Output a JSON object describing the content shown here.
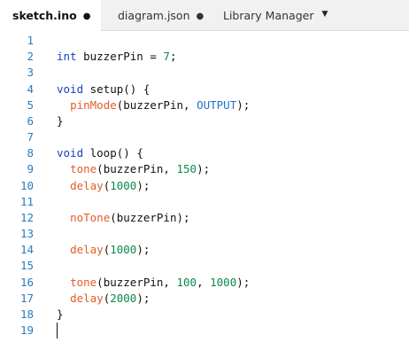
{
  "tabs": [
    {
      "label": "sketch.ino",
      "modified": "●",
      "active": true
    },
    {
      "label": "diagram.json",
      "modified": "●",
      "active": false
    },
    {
      "label": "Library Manager",
      "active": false
    }
  ],
  "more_icon": "▼",
  "colors": {
    "keyword": "#1a3fbf",
    "function": "#e35d26",
    "number": "#0b8a4a",
    "constant": "#1f74c8",
    "plain": "#111111",
    "line_number": "#2a7bbd"
  },
  "editor": {
    "lines": [
      {
        "number": "1",
        "tokens": []
      },
      {
        "number": "2",
        "tokens": [
          {
            "t": "int",
            "c": "keyword"
          },
          {
            "t": " buzzerPin = ",
            "c": "plain"
          },
          {
            "t": "7",
            "c": "number"
          },
          {
            "t": ";",
            "c": "plain"
          }
        ]
      },
      {
        "number": "3",
        "tokens": []
      },
      {
        "number": "4",
        "tokens": [
          {
            "t": "void",
            "c": "keyword"
          },
          {
            "t": " setup() {",
            "c": "plain"
          }
        ]
      },
      {
        "number": "5",
        "tokens": [
          {
            "t": "  ",
            "c": "plain"
          },
          {
            "t": "pinMode",
            "c": "function"
          },
          {
            "t": "(buzzerPin, ",
            "c": "plain"
          },
          {
            "t": "OUTPUT",
            "c": "constant"
          },
          {
            "t": ");",
            "c": "plain"
          }
        ]
      },
      {
        "number": "6",
        "tokens": [
          {
            "t": "}",
            "c": "plain"
          }
        ]
      },
      {
        "number": "7",
        "tokens": []
      },
      {
        "number": "8",
        "tokens": [
          {
            "t": "void",
            "c": "keyword"
          },
          {
            "t": " loop() {",
            "c": "plain"
          }
        ]
      },
      {
        "number": "9",
        "tokens": [
          {
            "t": "  ",
            "c": "plain"
          },
          {
            "t": "tone",
            "c": "function"
          },
          {
            "t": "(buzzerPin, ",
            "c": "plain"
          },
          {
            "t": "150",
            "c": "number"
          },
          {
            "t": ");",
            "c": "plain"
          }
        ]
      },
      {
        "number": "10",
        "tokens": [
          {
            "t": "  ",
            "c": "plain"
          },
          {
            "t": "delay",
            "c": "function"
          },
          {
            "t": "(",
            "c": "plain"
          },
          {
            "t": "1000",
            "c": "number"
          },
          {
            "t": ");",
            "c": "plain"
          }
        ]
      },
      {
        "number": "11",
        "tokens": []
      },
      {
        "number": "12",
        "tokens": [
          {
            "t": "  ",
            "c": "plain"
          },
          {
            "t": "noTone",
            "c": "function"
          },
          {
            "t": "(buzzerPin);",
            "c": "plain"
          }
        ]
      },
      {
        "number": "13",
        "tokens": []
      },
      {
        "number": "14",
        "tokens": [
          {
            "t": "  ",
            "c": "plain"
          },
          {
            "t": "delay",
            "c": "function"
          },
          {
            "t": "(",
            "c": "plain"
          },
          {
            "t": "1000",
            "c": "number"
          },
          {
            "t": ");",
            "c": "plain"
          }
        ]
      },
      {
        "number": "15",
        "tokens": []
      },
      {
        "number": "16",
        "tokens": [
          {
            "t": "  ",
            "c": "plain"
          },
          {
            "t": "tone",
            "c": "function"
          },
          {
            "t": "(buzzerPin, ",
            "c": "plain"
          },
          {
            "t": "100",
            "c": "number"
          },
          {
            "t": ", ",
            "c": "plain"
          },
          {
            "t": "1000",
            "c": "number"
          },
          {
            "t": ");",
            "c": "plain"
          }
        ]
      },
      {
        "number": "17",
        "tokens": [
          {
            "t": "  ",
            "c": "plain"
          },
          {
            "t": "delay",
            "c": "function"
          },
          {
            "t": "(",
            "c": "plain"
          },
          {
            "t": "2000",
            "c": "number"
          },
          {
            "t": ");",
            "c": "plain"
          }
        ]
      },
      {
        "number": "18",
        "tokens": [
          {
            "t": "}",
            "c": "plain"
          }
        ]
      },
      {
        "number": "19",
        "tokens": []
      }
    ]
  }
}
